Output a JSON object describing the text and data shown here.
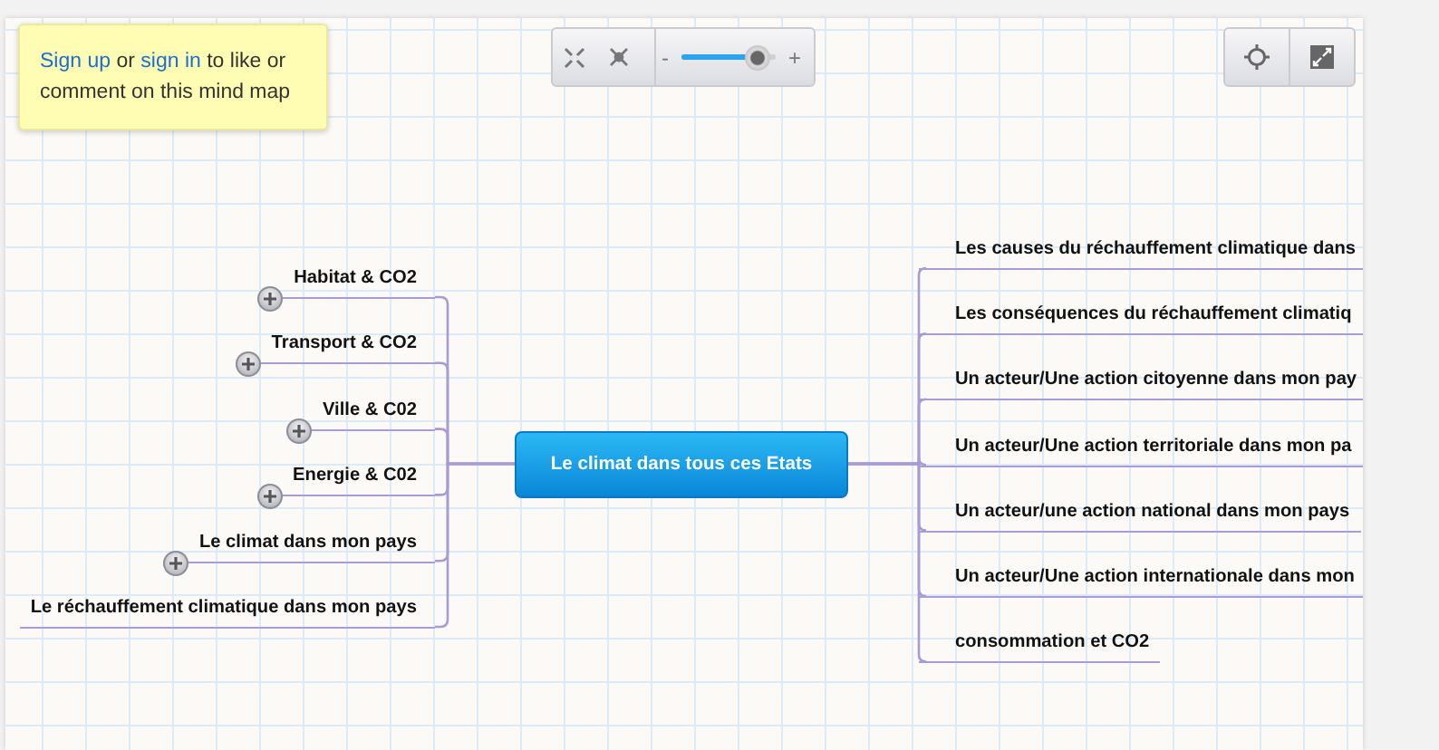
{
  "prompt": {
    "signup_link": "Sign up",
    "or": "or",
    "signin_link": "sign in",
    "text": "to like or comment on this mind map"
  },
  "toolbar": {
    "zoom_out": "-",
    "zoom_in": "+",
    "zoom": {
      "level": 0.8
    }
  },
  "root": {
    "title": "Le climat dans tous ces Etats"
  },
  "left": [
    {
      "title": "Habitat & CO2",
      "collapsed": true
    },
    {
      "title": "Transport & CO2",
      "collapsed": true
    },
    {
      "title": "Ville & C02",
      "collapsed": true
    },
    {
      "title": "Energie & C02",
      "collapsed": true
    },
    {
      "title": "Le climat dans mon pays",
      "collapsed": true
    },
    {
      "title": "Le réchauffement climatique dans mon pays",
      "collapsed": false
    }
  ],
  "right": [
    {
      "title": "Les causes du réchauffement climatique dans"
    },
    {
      "title": "Les conséquences du réchauffement climatiq"
    },
    {
      "title": "Un acteur/Une action citoyenne dans mon pay"
    },
    {
      "title": "Un acteur/Une action territoriale dans mon pa"
    },
    {
      "title": "Un acteur/une action national dans mon pays"
    },
    {
      "title": "Un acteur/Une action internationale dans mon"
    },
    {
      "title": "consommation et CO2"
    }
  ]
}
